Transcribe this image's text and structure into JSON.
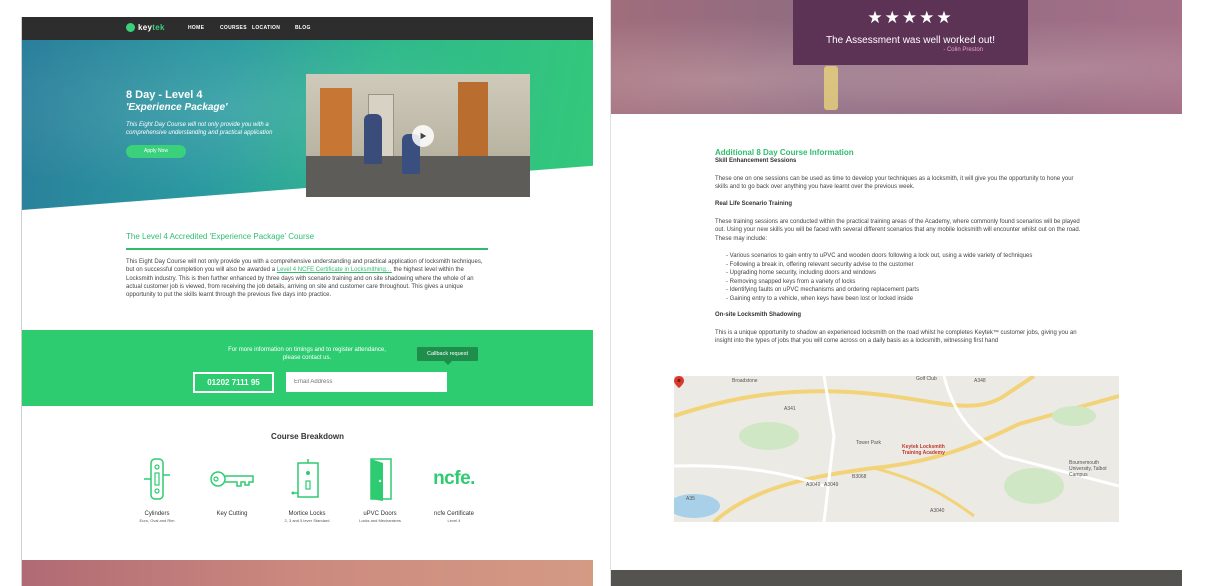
{
  "left_page": {
    "nav": {
      "logo": {
        "prefix": "key",
        "suffix": "tek"
      },
      "links": [
        "HOME",
        "COURSES",
        "LOCATION",
        "BLOG"
      ]
    },
    "hero": {
      "title": "8 Day - Level 4",
      "subtitle": "'Experience Package'",
      "description": "This Eight Day Course will not only provide you with a comprehensive understanding and practical application",
      "apply_label": "Apply Now"
    },
    "course": {
      "title": "The Level 4 Accredited 'Experience Package' Course",
      "body_1": "This Eight Day Course will not only provide you with a comprehensive understanding and practical application of locksmith techniques, but on successful completion you will also be awarded a ",
      "link": "Level 4 NCFE Certificate in Locksmithing…",
      "body_2": " the highest level within the Locksmith industry. This is then further enhanced by three days with scenario training and on site shadowing where the whole of an actual customer job is viewed, from receiving the job details, arriving on site and customer care throughout. This gives a unique opportunity to put the skills learnt through the previous five days into practice."
    },
    "cta": {
      "text": "For more information on timings and to register attendance, please contact us.",
      "callback_label": "Callback request",
      "phone": "01202 7111 95",
      "email_placeholder": "Email Address"
    },
    "breakdown": {
      "title": "Course Breakdown",
      "items": [
        {
          "label": "Cylinders",
          "sub": "Euro, Oval and Rim",
          "icon": "cylinder-lock-icon"
        },
        {
          "label": "Key Cutting",
          "sub": "",
          "icon": "key-icon"
        },
        {
          "label": "Mortice Locks",
          "sub": "2, 3 and 5 lever Standard",
          "icon": "mortice-lock-icon"
        },
        {
          "label": "uPVC Doors",
          "sub": "Locks and Mechanisms",
          "icon": "door-icon"
        },
        {
          "label": "ncfe Certificate",
          "sub": "Level 4",
          "icon": "ncfe-logo",
          "logo_text": "ncfe."
        }
      ]
    }
  },
  "right_page": {
    "testimonial": {
      "stars": "★★★★★",
      "rating": 5,
      "quote": "The Assessment was well worked out!",
      "author": "- Colin Preston"
    },
    "additional": {
      "title": "Additional 8 Day Course Information",
      "skill_heading": "Skill Enhancement Sessions",
      "skill_text": "These one on one sessions can be used as time to develop your techniques as a locksmith, it will give you the opportunity to hone your skills and to go back over anything you have learnt over the previous week.",
      "real_life_heading": "Real Life Scenario Training",
      "real_life_text": "These training sessions are conducted within the practical training areas of the Academy, where commonly found scenarios will be played out. Using your new skills you will be faced with several different scenarios that any mobile locksmith will encounter whilst out on the road. These may include:",
      "bullets": [
        "- Various scenarios to gain entry to uPVC and wooden doors following a lock out, using a wide variety of techniques",
        "- Following a break in, offering relevant security advise to the customer",
        "- Upgrading home security, including doors and windows",
        "- Removing snapped keys from a variety of locks",
        "- Identifying faults on uPVC mechanisms and ordering replacement parts",
        "- Gaining entry to a vehicle, when keys have been lost or locked inside"
      ],
      "shadow_heading": "On-site Locksmith Shadowing",
      "shadow_text": "This is a unique opportunity to shadow an experienced locksmith on the road whilst he completes Keytek™ customer jobs, giving you an insight into the types of jobs that you will come across on a daily basis as a locksmith, witnessing first hand"
    },
    "map": {
      "labels": [
        "Broadstone",
        "Golf Club",
        "Tower Park",
        "Bournemouth University, Talbot Campus",
        "A35",
        "A3049",
        "A348",
        "A341",
        "A3049",
        "B3068",
        "A3040"
      ],
      "pin_label": "Keytek Locksmith Training Academy"
    }
  },
  "colors": {
    "green": "#2ecc71",
    "dark_green": "#1f8e4c",
    "nav": "#2d2d2d",
    "plum": "#5d3355"
  }
}
